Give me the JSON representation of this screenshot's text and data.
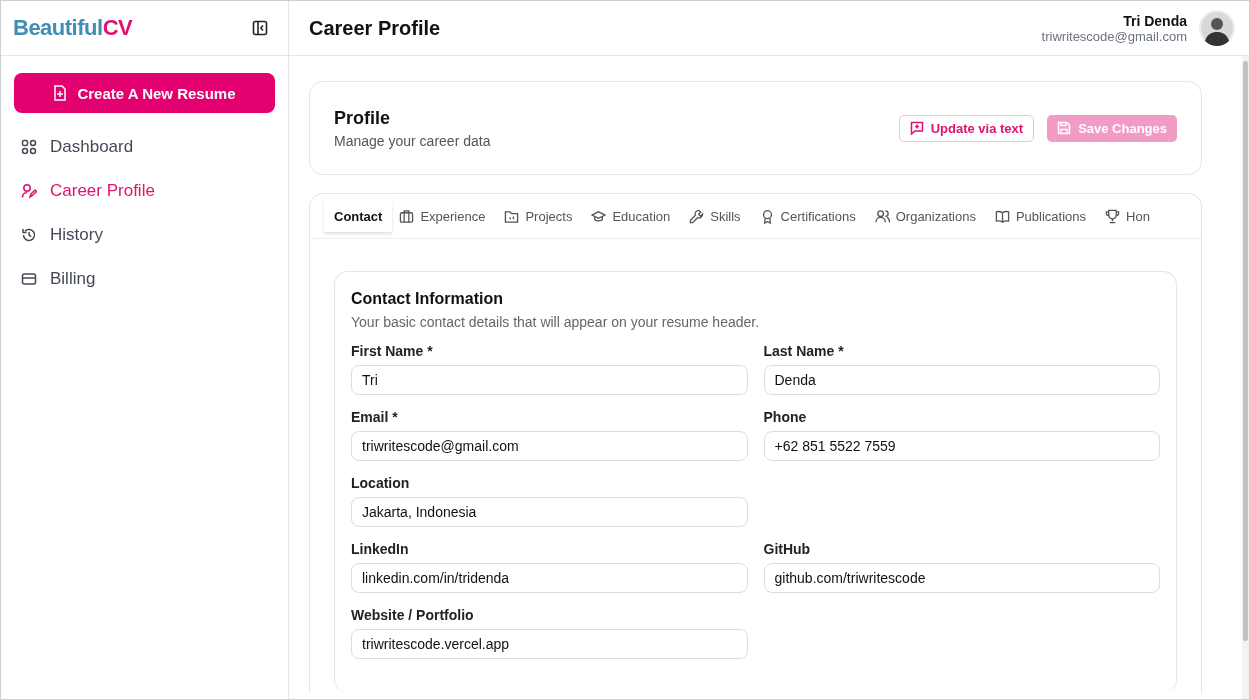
{
  "logo": {
    "part1": "Beautiful",
    "part2": "CV"
  },
  "sidebar": {
    "create_button": "Create A New Resume",
    "items": [
      {
        "label": "Dashboard",
        "selected": false
      },
      {
        "label": "Career Profile",
        "selected": true
      },
      {
        "label": "History",
        "selected": false
      },
      {
        "label": "Billing",
        "selected": false
      }
    ]
  },
  "header": {
    "title": "Career Profile",
    "user_name": "Tri Denda",
    "user_email": "triwritescode@gmail.com"
  },
  "profile": {
    "title": "Profile",
    "subtitle": "Manage your career data",
    "buttons": [
      {
        "label": "Update via text",
        "kind": "outline",
        "disabled": false
      },
      {
        "label": "Save Changes",
        "kind": "primary",
        "disabled": true
      }
    ]
  },
  "tabs": [
    {
      "label": "Contact",
      "selected": true
    },
    {
      "label": "Experience",
      "selected": false
    },
    {
      "label": "Projects",
      "selected": false
    },
    {
      "label": "Education",
      "selected": false
    },
    {
      "label": "Skills",
      "selected": false
    },
    {
      "label": "Certifications",
      "selected": false
    },
    {
      "label": "Organizations",
      "selected": false
    },
    {
      "label": "Publications",
      "selected": false
    },
    {
      "label": "Hon",
      "selected": false
    }
  ],
  "contact": {
    "title": "Contact Information",
    "description": "Your basic contact details that will appear on your resume header.",
    "rows": [
      [
        {
          "label": "First Name *",
          "value": "Tri"
        },
        {
          "label": "Last Name *",
          "value": "Denda"
        }
      ],
      [
        {
          "label": "Email *",
          "value": "triwritescode@gmail.com"
        },
        {
          "label": "Phone",
          "value": "+62 851 5522 7559"
        }
      ],
      [
        {
          "label": "Location",
          "value": "Jakarta, Indonesia"
        }
      ],
      [
        {
          "label": "LinkedIn",
          "value": "linkedin.com/in/tridenda"
        },
        {
          "label": "GitHub",
          "value": "github.com/triwritescode"
        }
      ],
      [
        {
          "label": "Website / Portfolio",
          "value": "triwritescode.vercel.app"
        }
      ]
    ]
  }
}
